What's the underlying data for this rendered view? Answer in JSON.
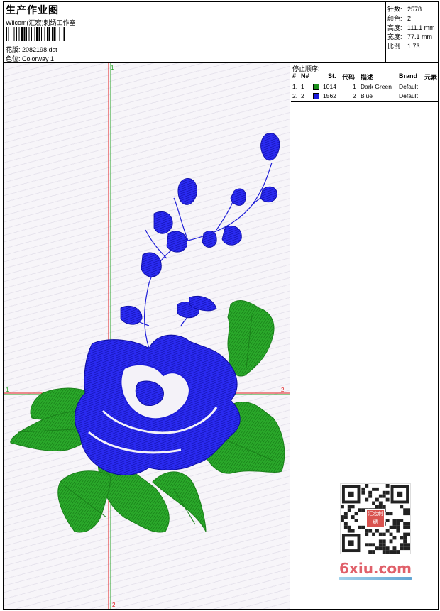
{
  "header": {
    "title": "生产作业图",
    "company": "Wilcom(汇宏)刺绣工作室",
    "design_label": "花版:",
    "design_value": "2082198.dst",
    "color_label": "色位:",
    "color_value": "Colorway 1"
  },
  "stats": [
    {
      "label": "针数:",
      "value": "2578"
    },
    {
      "label": "颜色:",
      "value": "2"
    },
    {
      "label": "高度:",
      "value": "111.1 mm"
    },
    {
      "label": "宽度:",
      "value": "77.1 mm"
    },
    {
      "label": "比例:",
      "value": "1.73"
    }
  ],
  "stop_sequence": {
    "title": "停止顺序:",
    "columns": [
      "#",
      "N#",
      "St.",
      "代码",
      "描述",
      "Brand",
      "元素"
    ],
    "rows": [
      {
        "idx": "1.",
        "n": "1",
        "color": "#1a8f1a",
        "st": "1014",
        "code": "1",
        "desc": "Dark Green",
        "brand": "Default"
      },
      {
        "idx": "2.",
        "n": "2",
        "color": "#1a1adc",
        "st": "1562",
        "code": "2",
        "desc": "Blue",
        "brand": "Default"
      }
    ]
  },
  "guides": {
    "top_marker": "1",
    "left_marker": "1",
    "right_marker": "2",
    "bottom_marker": "2"
  },
  "watermark": {
    "site": "6xiu.com",
    "badge": "汇宏刺绣"
  },
  "colors": {
    "green_thread": "#1f9a1f",
    "blue_thread": "#1c1cd8",
    "guide_red": "#e02020",
    "guide_green": "#20a020"
  }
}
